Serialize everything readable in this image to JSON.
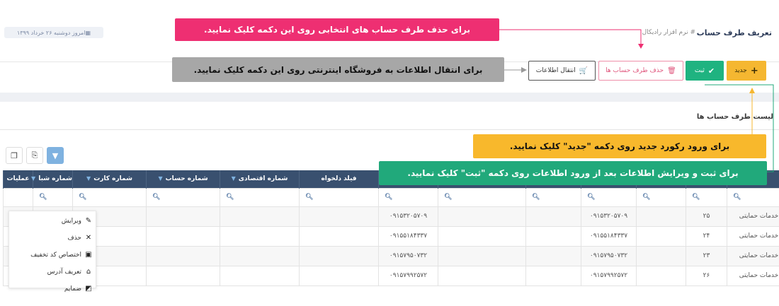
{
  "header": {
    "title": "تعریف طرف حساب",
    "subtitle": "# نرم افزار رادیکال",
    "date": "امروز دوشنبه ۲۶ خرداد ۱۳۹۹"
  },
  "toolbar": {
    "new_label": "جدید",
    "save_label": "ثبت",
    "delete_label": "حذف طرف حساب ها",
    "transfer_label": "انتقال اطلاعات"
  },
  "list": {
    "title": "لیست طرف حساب ها"
  },
  "table": {
    "columns": [
      "",
      "",
      "",
      "",
      "",
      "",
      "",
      "",
      "فیلد دلخواه",
      "شماره اقتصادی",
      "شماره حساب",
      "شماره کارت",
      "شماره شبا",
      "عملیات"
    ],
    "filter_icon": "search-icon",
    "rows": [
      [
        "خدمات حمایتی",
        "۲۵",
        "۰۹۱۵۳۲۰۵۷۰۹",
        "۰۹۱۵۳۲۰۵۷۰۹"
      ],
      [
        "خدمات حمایتی",
        "۲۴",
        "۰۹۱۵۵۱۸۴۳۳۷",
        "۰۹۱۵۵۱۸۴۳۳۷"
      ],
      [
        "خدمات حمایتی",
        "۲۳",
        "۰۹۱۵۷۹۵۰۷۳۲",
        "۰۹۱۵۷۹۵۰۷۳۲"
      ],
      [
        "خدمات حمایتی",
        "۲۶",
        "۰۹۱۵۷۹۹۲۵۷۲",
        "۰۹۱۵۷۹۹۲۵۷۲"
      ]
    ]
  },
  "menu": {
    "items": [
      {
        "label": "ویرایش",
        "icon": "pencil-icon"
      },
      {
        "label": "حذف",
        "icon": "close-icon"
      },
      {
        "label": "اختصاص کد تخفیف",
        "icon": "gift-icon"
      },
      {
        "label": "تعریف آدرس",
        "icon": "home-icon"
      },
      {
        "label": "ضمایم",
        "icon": "attachment-icon"
      }
    ]
  },
  "notes": {
    "delete": "برای حذف طرف حساب های انتخابی روی این دکمه کلیک نمایید.",
    "transfer": "برای انتقال اطلاعات به فروشگاه اینترنتی  روی این دکمه کلیک نمایید.",
    "new": "برای ورود رکورد جدید روی دکمه \"جدید\" کلیک نمایید.",
    "save": "برای ثبت و ویرایش اطلاعات بعد از ورود اطلاعات روی دکمه \"ثبت\" کلیک نمایید."
  },
  "colors": {
    "header_blue": "#39506f",
    "new_button": "#f5b731",
    "save_button": "#1fb380",
    "delete_border": "#ef8fa9",
    "note_pink": "#ee2f72",
    "note_gray": "#a7a7a7",
    "note_yellow": "#f8b82c",
    "note_green": "#21a97b"
  }
}
